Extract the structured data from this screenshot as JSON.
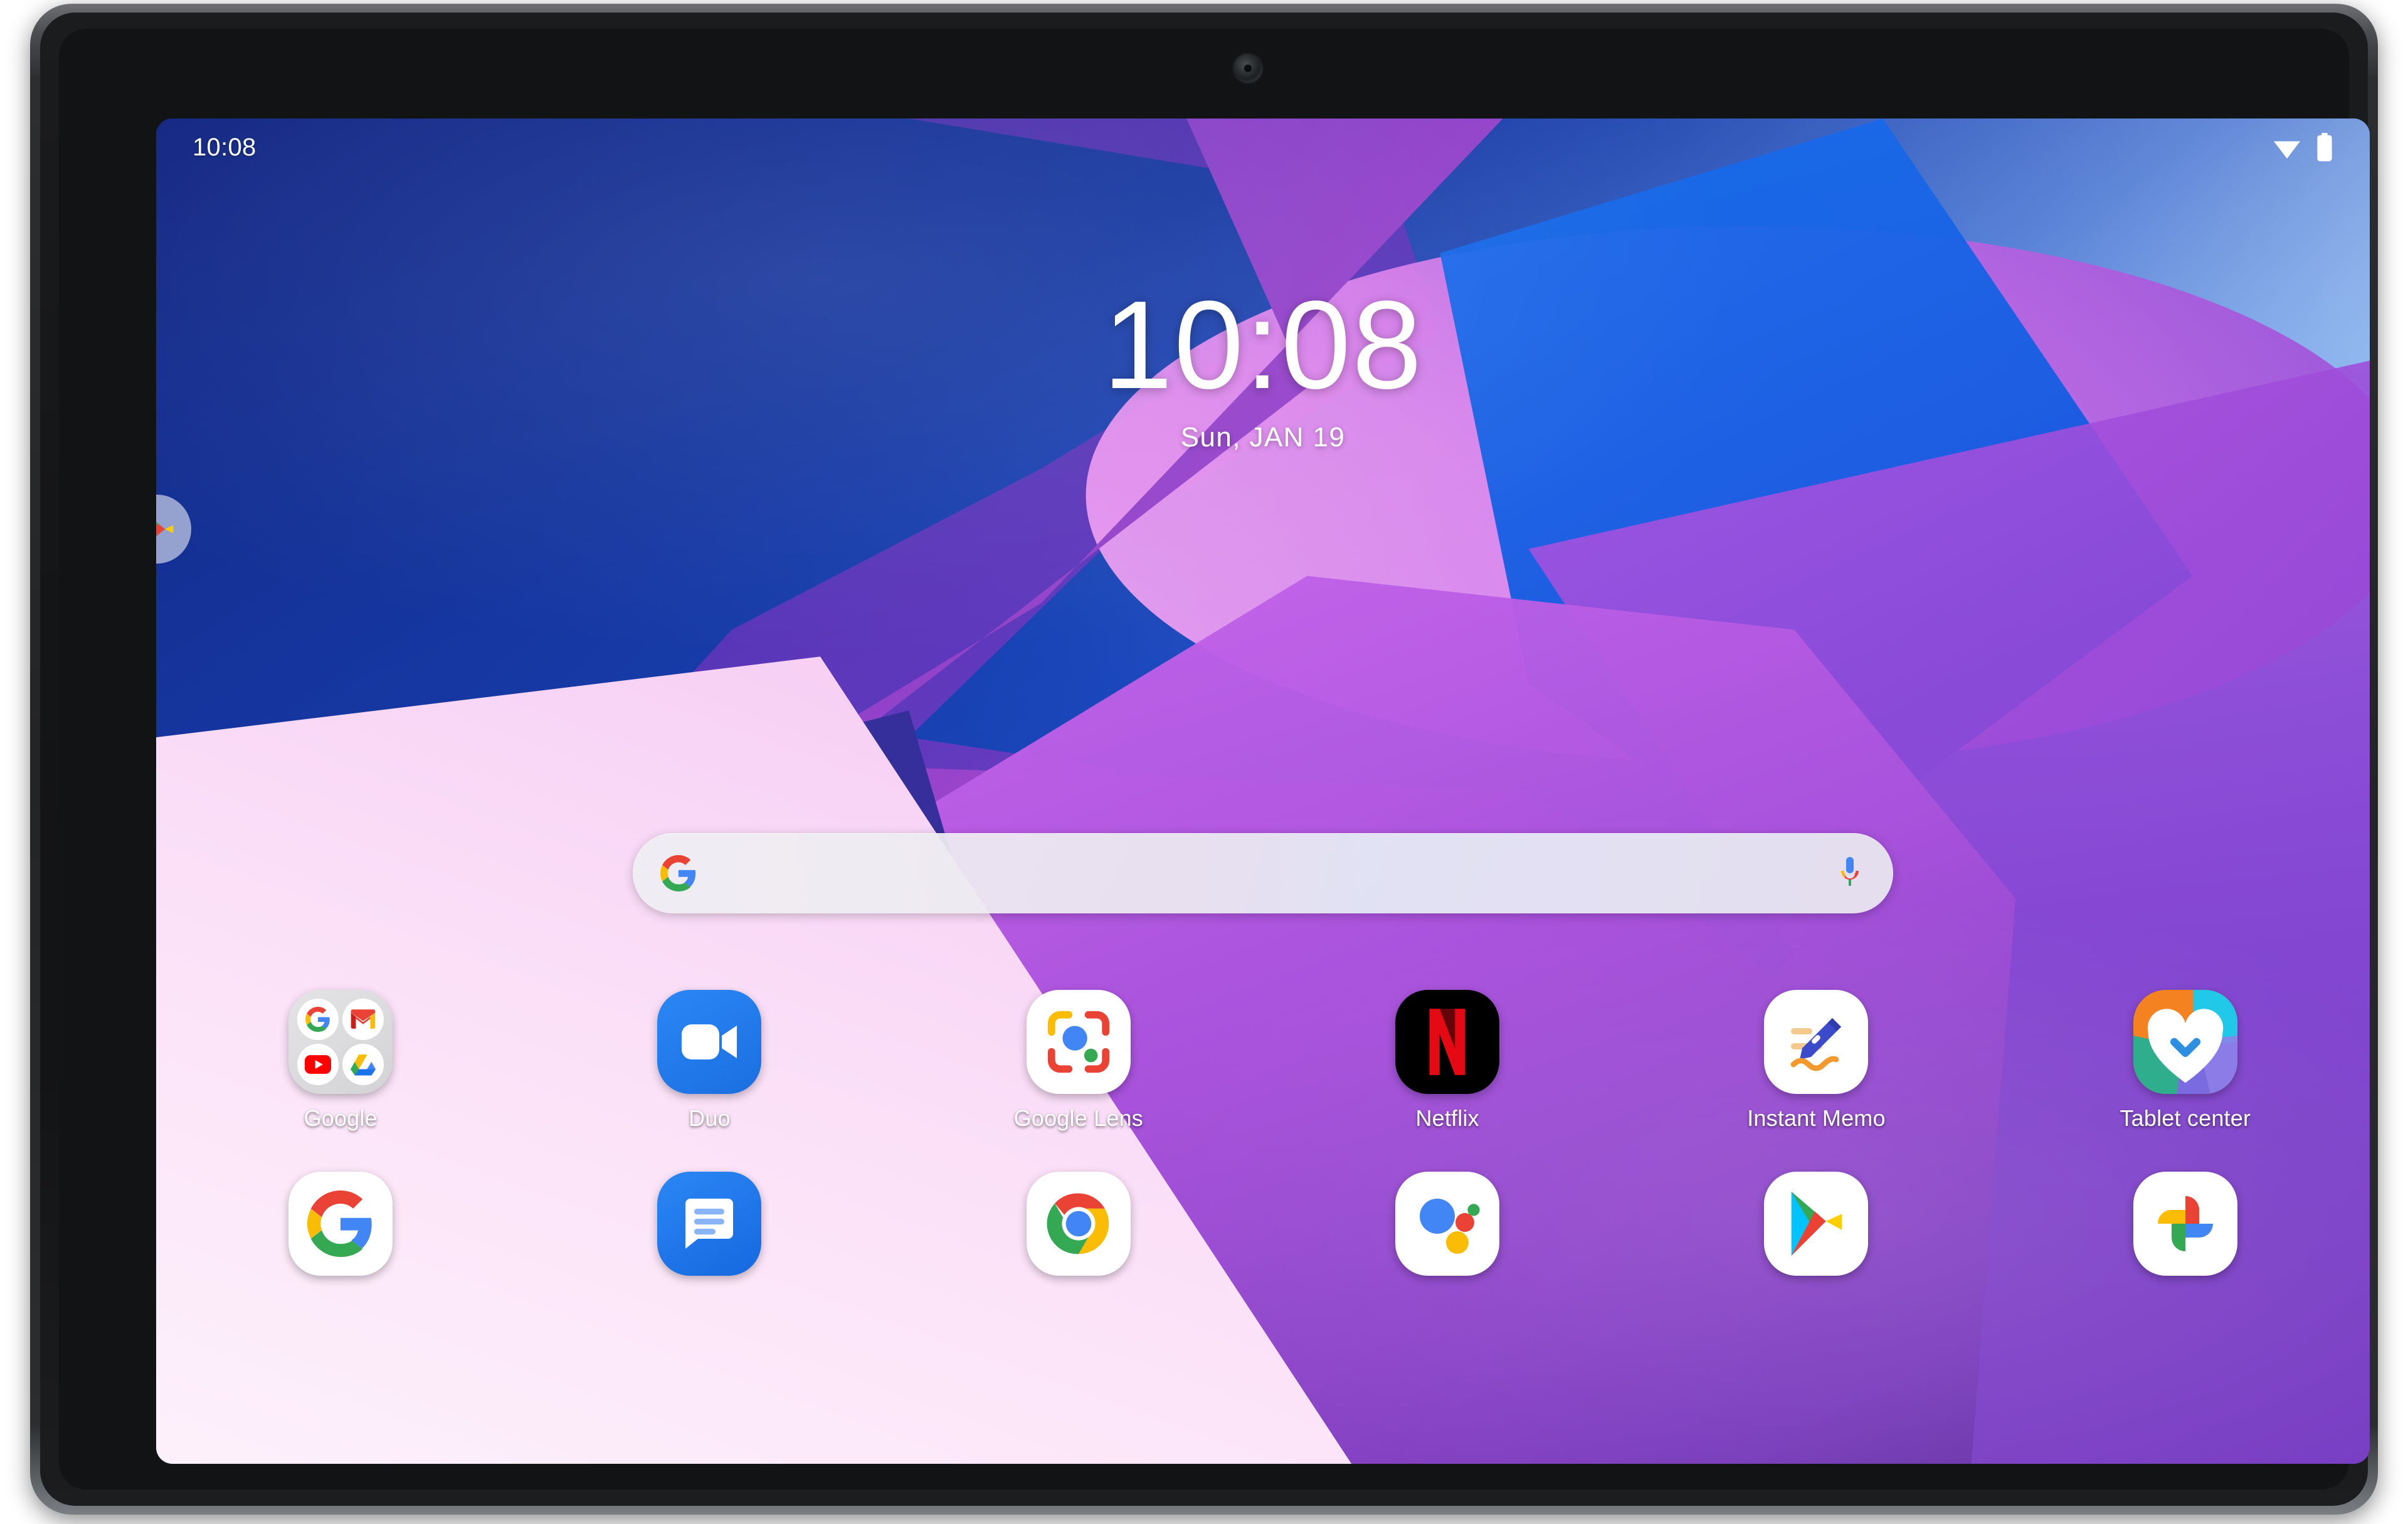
{
  "device": {
    "type": "android-tablet",
    "front_camera": "front-camera"
  },
  "status_bar": {
    "time": "10:08",
    "icons": [
      "wifi-icon",
      "battery-icon"
    ]
  },
  "clock_widget": {
    "time": "10:08",
    "date": "Sun, JAN 19"
  },
  "search": {
    "value": "",
    "placeholder": "",
    "leading_icon": "google-g-icon",
    "trailing_icon": "microphone-icon"
  },
  "page_peek": {
    "icon": "play-store-icon"
  },
  "apps": {
    "row1": [
      {
        "label": "Google",
        "icon": "google-folder-icon",
        "folder_apps": [
          "google-search",
          "gmail",
          "youtube",
          "google-drive"
        ]
      },
      {
        "label": "Duo",
        "icon": "google-duo-icon"
      },
      {
        "label": "Google Lens",
        "icon": "google-lens-icon"
      },
      {
        "label": "Netflix",
        "icon": "netflix-icon"
      },
      {
        "label": "Instant Memo",
        "icon": "instant-memo-icon"
      },
      {
        "label": "Tablet center",
        "icon": "tablet-center-icon"
      }
    ],
    "row2": [
      {
        "label": "",
        "icon": "google-search-icon"
      },
      {
        "label": "",
        "icon": "google-messages-icon"
      },
      {
        "label": "",
        "icon": "google-chrome-icon"
      },
      {
        "label": "",
        "icon": "google-assistant-icon"
      },
      {
        "label": "",
        "icon": "google-play-store-icon"
      },
      {
        "label": "",
        "icon": "google-photos-icon"
      }
    ]
  },
  "colors": {
    "google_blue": "#4285F4",
    "google_red": "#EA4335",
    "google_yellow": "#FBBC05",
    "google_green": "#34A853",
    "netflix_red": "#E50914",
    "duo_blue": "#1A73E8",
    "messages_blue": "#1B75E8",
    "memo_indigo": "#3B4BC9",
    "memo_orange": "#F29A2E",
    "wallpaper_pink": "#F7B8F2",
    "wallpaper_violet": "#8B4AD2",
    "wallpaper_navy": "#1B3EA8",
    "label_text": "#FFFFFF"
  }
}
